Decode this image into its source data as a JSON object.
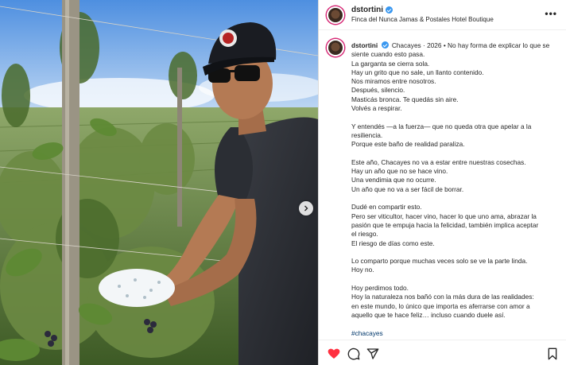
{
  "post": {
    "username": "dstortini",
    "location": "Finca del Nunca Jamas & Postales Hotel Boutique"
  },
  "caption": {
    "username": "dstortini",
    "lines": [
      "Chacayes · 2026 • No hay forma de explicar lo que se",
      "siente cuando esto pasa.",
      "La garganta se cierra sola.",
      "Hay un grito que no sale, un llanto contenido.",
      "Nos miramos entre nosotros.",
      "Después, silencio.",
      "Masticás bronca. Te quedás sin aire.",
      "Volvés a respirar.",
      "",
      "Y entendés —a la fuerza— que no queda otra que apelar a la",
      "resiliencia.",
      "Porque este baño de realidad paraliza.",
      "",
      "Este año, Chacayes no va a estar entre nuestras cosechas.",
      "Hay un año que no se hace vino.",
      "Una vendimia que no ocurre.",
      "Un año que no va a ser fácil de borrar.",
      "",
      "Dudé en compartir esto.",
      "Pero ser viticultor, hacer vino, hacer lo que uno ama, abrazar la",
      "pasión que te empuja hacia la felicidad, también implica aceptar",
      "el riesgo.",
      "El riesgo de días como este.",
      "",
      "Lo comparto porque muchas veces solo se ve la parte linda.",
      "Hoy no.",
      "",
      "Hoy perdimos todo.",
      "Hoy la naturaleza nos bañó con la más dura de las realidades:",
      "en este mundo, lo único que importa es aferrarse con amor a",
      "aquello que te hace feliz… incluso cuando duele así."
    ],
    "hashtag": "#chacayes"
  },
  "icons": {
    "more": "more-icon",
    "like": "heart-icon",
    "comment": "comment-icon",
    "share": "share-icon",
    "save": "bookmark-icon",
    "next": "chevron-right-icon",
    "verified": "verified-badge-icon"
  },
  "colors": {
    "like": "#ff3040",
    "hashtag": "#00376b",
    "verified": "#3897f0"
  }
}
